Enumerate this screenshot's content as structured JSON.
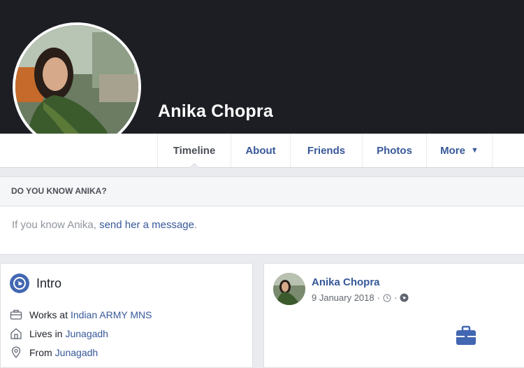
{
  "profile": {
    "name": "Anika Chopra"
  },
  "tabs": [
    {
      "label": "Timeline",
      "active": true
    },
    {
      "label": "About"
    },
    {
      "label": "Friends"
    },
    {
      "label": "Photos"
    },
    {
      "label": "More"
    }
  ],
  "know": {
    "heading": "DO YOU KNOW ANIKA?",
    "text_prefix": "If you know Anika,",
    "link": "send her a message",
    "text_suffix": "."
  },
  "intro": {
    "title": "Intro",
    "items": [
      {
        "icon": "briefcase-icon",
        "prefix": "Works at",
        "link": "Indian ARMY MNS"
      },
      {
        "icon": "house-icon",
        "prefix": "Lives in",
        "link": "Junagadh"
      },
      {
        "icon": "location-pin-icon",
        "prefix": "From",
        "link": "Junagadh"
      }
    ]
  },
  "post": {
    "author": "Anika Chopra",
    "date": "9 January 2018",
    "separator": "·"
  },
  "colors": {
    "link": "#365899",
    "cover": "#1d1e24",
    "background": "#e9ebee"
  }
}
